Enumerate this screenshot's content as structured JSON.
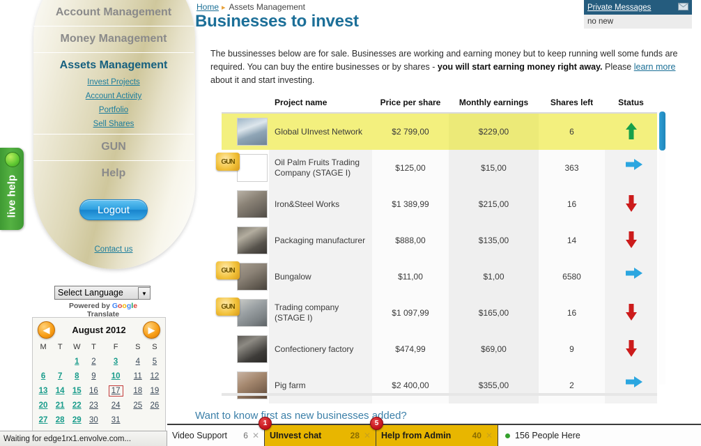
{
  "live_help": {
    "label": "live help"
  },
  "sidebar": {
    "top_items": [
      {
        "label": "Account Management",
        "active": false
      },
      {
        "label": "Money Management",
        "active": false
      },
      {
        "label": "Assets Management",
        "active": true
      }
    ],
    "sub_items": [
      {
        "label": "Invest Projects"
      },
      {
        "label": "Account Activity"
      },
      {
        "label": "Portfolio"
      },
      {
        "label": "Sell Shares"
      }
    ],
    "bottom_items": [
      {
        "label": "GUN"
      },
      {
        "label": "Help"
      }
    ],
    "logout_label": "Logout",
    "contact_label": "Contact us"
  },
  "language": {
    "selected": "Select Language",
    "credit_prefix": "Powered by",
    "credit_google": "Google",
    "credit_suffix": "Translate"
  },
  "calendar": {
    "title": "August 2012",
    "prev_icon": "left-arrow-icon",
    "next_icon": "right-arrow-icon",
    "weekdays": [
      "M",
      "T",
      "W",
      "T",
      "F",
      "S",
      "S"
    ],
    "weeks": [
      [
        {
          "d": "",
          "t": ""
        },
        {
          "d": "",
          "t": ""
        },
        {
          "d": "1",
          "t": "on"
        },
        {
          "d": "2",
          "t": "off"
        },
        {
          "d": "3",
          "t": "on"
        },
        {
          "d": "4",
          "t": "off"
        },
        {
          "d": "5",
          "t": "off"
        }
      ],
      [
        {
          "d": "6",
          "t": "on"
        },
        {
          "d": "7",
          "t": "on"
        },
        {
          "d": "8",
          "t": "on"
        },
        {
          "d": "9",
          "t": "off"
        },
        {
          "d": "10",
          "t": "on"
        },
        {
          "d": "11",
          "t": "off"
        },
        {
          "d": "12",
          "t": "off"
        }
      ],
      [
        {
          "d": "13",
          "t": "on"
        },
        {
          "d": "14",
          "t": "on"
        },
        {
          "d": "15",
          "t": "on"
        },
        {
          "d": "16",
          "t": "off"
        },
        {
          "d": "17",
          "t": "today"
        },
        {
          "d": "18",
          "t": "off"
        },
        {
          "d": "19",
          "t": "off"
        }
      ],
      [
        {
          "d": "20",
          "t": "on"
        },
        {
          "d": "21",
          "t": "on"
        },
        {
          "d": "22",
          "t": "on"
        },
        {
          "d": "23",
          "t": "off"
        },
        {
          "d": "24",
          "t": "off"
        },
        {
          "d": "25",
          "t": "off"
        },
        {
          "d": "26",
          "t": "off"
        }
      ],
      [
        {
          "d": "27",
          "t": "on"
        },
        {
          "d": "28",
          "t": "on"
        },
        {
          "d": "29",
          "t": "on"
        },
        {
          "d": "30",
          "t": "off"
        },
        {
          "d": "31",
          "t": "off"
        },
        {
          "d": "",
          "t": ""
        },
        {
          "d": "",
          "t": ""
        }
      ]
    ]
  },
  "breadcrumb": {
    "home": "Home",
    "separator": "▸",
    "current": "Assets Management"
  },
  "page_title": "Businesses to invest",
  "private_messages": {
    "link_label": "Private Messages",
    "envelope_icon": "envelope-icon",
    "status": "no new"
  },
  "intro": {
    "part1": "The bussinesses below are for sale. Businesses are working and earning money but to keep running well some funds are required. You can buy the entire businesses or by shares - ",
    "bold": "you will start earning money right away.",
    "part2": " Please ",
    "link": "learn more",
    "part3": " about it and start investing."
  },
  "table": {
    "headers": [
      "",
      "Project name",
      "Price per share",
      "Monthly earnings",
      "Shares left",
      "Status"
    ],
    "rows": [
      {
        "thumb": "t-build",
        "gun": false,
        "name": "Global UInvest Network",
        "price": "$2 799,00",
        "earnings": "$229,00",
        "shares": "6",
        "status": "up",
        "highlighted": true
      },
      {
        "thumb": "t-truck",
        "gun": true,
        "name": "Oil Palm Fruits Trading Company (STAGE I)",
        "price": "$125,00",
        "earnings": "$15,00",
        "shares": "363",
        "status": "right",
        "highlighted": false
      },
      {
        "thumb": "t-iron",
        "gun": false,
        "name": "Iron&Steel Works",
        "price": "$1 389,99",
        "earnings": "$215,00",
        "shares": "16",
        "status": "down",
        "highlighted": false
      },
      {
        "thumb": "t-pack",
        "gun": false,
        "name": "Packaging manufacturer",
        "price": "$888,00",
        "earnings": "$135,00",
        "shares": "14",
        "status": "down",
        "highlighted": false
      },
      {
        "thumb": "t-bung",
        "gun": true,
        "name": "Bungalow",
        "price": "$11,00",
        "earnings": "$1,00",
        "shares": "6580",
        "status": "right",
        "highlighted": false
      },
      {
        "thumb": "t-trade",
        "gun": true,
        "name": "Trading company (STAGE I)",
        "price": "$1 097,99",
        "earnings": "$165,00",
        "shares": "16",
        "status": "down",
        "highlighted": false
      },
      {
        "thumb": "t-conf",
        "gun": false,
        "name": "Confectionery factory",
        "price": "$474,99",
        "earnings": "$69,00",
        "shares": "9",
        "status": "down",
        "highlighted": false
      },
      {
        "thumb": "t-pig",
        "gun": false,
        "name": "Pig farm",
        "price": "$2 400,00",
        "earnings": "$355,00",
        "shares": "2",
        "status": "right",
        "highlighted": false
      }
    ],
    "gun_badge_text": "GUN"
  },
  "want_more": "Want to know first as new businesses added?",
  "chat": {
    "tabs": [
      {
        "label": "Video Support",
        "count": "6",
        "badge": "",
        "style": "white"
      },
      {
        "label": "UInvest chat",
        "count": "28",
        "badge": "1",
        "style": "gold"
      },
      {
        "label": "Help from Admin",
        "count": "40",
        "badge": "5",
        "style": "gold"
      }
    ],
    "close_icon": "close-icon",
    "people_here": "156 People Here"
  },
  "status_bar": {
    "text": "Waiting for edge1rx1.envolve.com..."
  },
  "colors": {
    "accent_blue": "#1c6f98",
    "link_teal": "#1a7c9c",
    "highlight_yellow": "#f3f07e",
    "status_up": "#17a04a",
    "status_down": "#cc1b1b",
    "status_right": "#2ba6e0",
    "chat_gold": "#e8b600",
    "badge_red": "#c1121a",
    "pm_header": "#255c7e"
  }
}
